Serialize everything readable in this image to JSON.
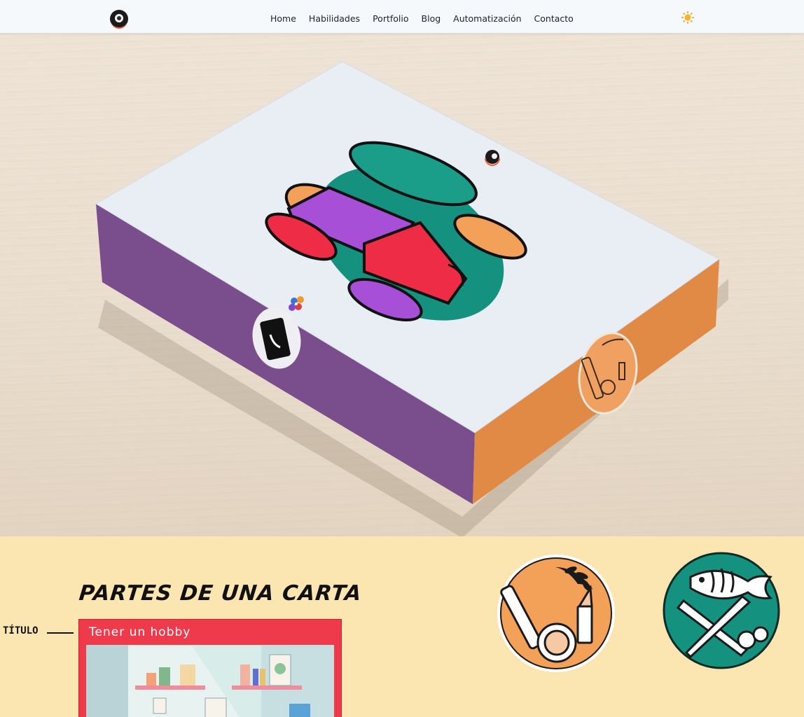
{
  "nav": {
    "logo": "logo-eye-icon",
    "links": [
      "Home",
      "Habilidades",
      "Portfolio",
      "Blog",
      "Automatización",
      "Contacto"
    ],
    "theme_toggle": "sun-icon"
  },
  "hero": {
    "image": "product-box-mockup",
    "box_colors": {
      "top": "#e9edf4",
      "left_side": "#7a4e8c",
      "right_side": "#e08a46"
    }
  },
  "section": {
    "title": "PARTES DE UNA CARTA",
    "label": "TÍTULO",
    "card_title": "Tener un hobby",
    "badges": [
      "beauty-comb-lipstick-icon",
      "fish-fork-knife-icon"
    ]
  },
  "colors": {
    "section_bg": "#fbe6b2",
    "card_red": "#ef3a4b",
    "badge_orange": "#f3a158",
    "badge_teal": "#14927f"
  }
}
